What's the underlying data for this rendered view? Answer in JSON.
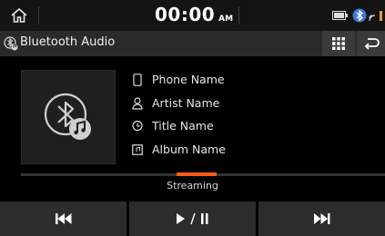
{
  "status_bar": {
    "time": "00:00",
    "ampm": "AM",
    "icons": [
      "home-icon",
      "battery-icon",
      "bluetooth-status-icon",
      "signal-icon"
    ]
  },
  "title_bar": {
    "title": "Bluetooth Audio",
    "icons": [
      "bluetooth-audio-icon",
      "menu-grid-icon",
      "back-icon"
    ]
  },
  "track_info": {
    "phone": "Phone Name",
    "artist": "Artist Name",
    "title": "Title Name",
    "album": "Album Name"
  },
  "playback": {
    "status": "Streaming",
    "accent_color": "#ff5a1a"
  },
  "controls": {
    "previous_label": "⏮",
    "play_pause_label": "▶ / ❚❚",
    "next_label": "⏭"
  }
}
